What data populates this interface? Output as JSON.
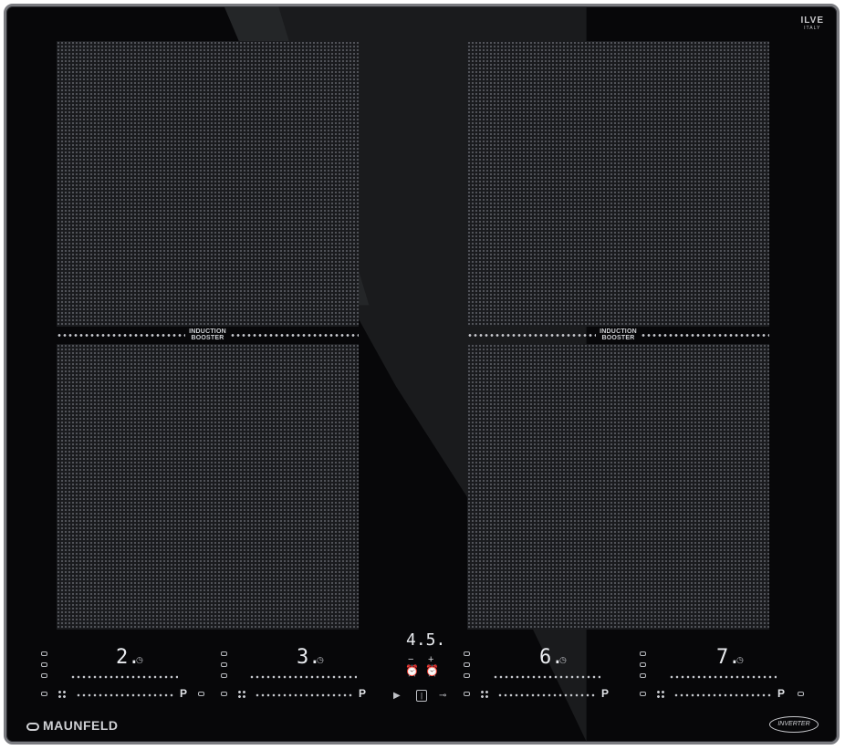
{
  "brand": {
    "top_logo": "ILVE",
    "top_sub": "ITALY",
    "bottom_logo": "MAUNFELD",
    "inverter_badge": "INVERTER"
  },
  "zones": {
    "booster_line1": "INDUCTION",
    "booster_line2": "BOOSTER"
  },
  "controls": {
    "zone_digits": [
      "2.",
      "3.",
      "6.",
      "7."
    ],
    "timer_display": "4.5.",
    "timer_minus": "−",
    "timer_plus": "+",
    "p_label": "P"
  },
  "colors": {
    "glass": "#070709",
    "frame": "#7a7b80",
    "indicator": "#e9ebef"
  }
}
